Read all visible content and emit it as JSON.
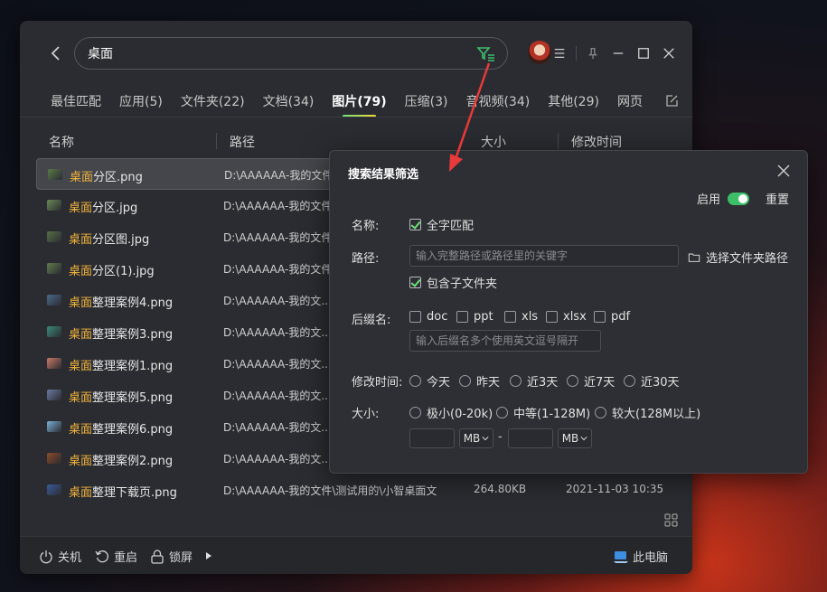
{
  "search": {
    "value": "桌面",
    "placeholder": ""
  },
  "tabs": [
    {
      "label": "最佳匹配"
    },
    {
      "label": "应用(5)"
    },
    {
      "label": "文件夹(22)"
    },
    {
      "label": "文档(34)"
    },
    {
      "label": "图片(79)",
      "active": true
    },
    {
      "label": "压缩(3)"
    },
    {
      "label": "音视频(34)"
    },
    {
      "label": "其他(29)"
    },
    {
      "label": "网页"
    }
  ],
  "columns": {
    "name": "名称",
    "path": "路径",
    "size": "大小",
    "modified": "修改时间"
  },
  "files": [
    {
      "hl": "桌面",
      "rest": "分区.png",
      "path": "D:\\AAAAAA-我的文件",
      "size": "",
      "date": "",
      "thumb": "#5a7a4a"
    },
    {
      "hl": "桌面",
      "rest": "分区.jpg",
      "path": "D:\\AAAAAA-我的文件",
      "size": "",
      "date": "",
      "thumb": "#6a8a56"
    },
    {
      "hl": "桌面",
      "rest": "分区图.jpg",
      "path": "D:\\AAAAAA-我的文件",
      "size": "",
      "date": "",
      "thumb": "#587048"
    },
    {
      "hl": "桌面",
      "rest": "分区(1).jpg",
      "path": "D:\\AAAAAA-我的文件",
      "size": "",
      "date": "",
      "thumb": "#607a4e"
    },
    {
      "hl": "桌面",
      "rest": "整理案例4.png",
      "path": "D:\\AAAAAA-我的文...",
      "size": "",
      "date": "",
      "thumb": "#4a6a8a"
    },
    {
      "hl": "桌面",
      "rest": "整理案例3.png",
      "path": "D:\\AAAAAA-我的文...",
      "size": "",
      "date": "",
      "thumb": "#3a8a7a"
    },
    {
      "hl": "桌面",
      "rest": "整理案例1.png",
      "path": "D:\\AAAAAA-我的文...",
      "size": "",
      "date": "",
      "thumb": "#c87a6a"
    },
    {
      "hl": "桌面",
      "rest": "整理案例5.png",
      "path": "D:\\AAAAAA-我的文...",
      "size": "",
      "date": "",
      "thumb": "#6a7aa0"
    },
    {
      "hl": "桌面",
      "rest": "整理案例6.png",
      "path": "D:\\AAAAAA-我的文...",
      "size": "",
      "date": "",
      "thumb": "#7ab0d8"
    },
    {
      "hl": "桌面",
      "rest": "整理案例2.png",
      "path": "D:\\AAAAAA-我的文...",
      "size": "",
      "date": "",
      "thumb": "#8a4a2a"
    },
    {
      "hl": "桌面",
      "rest": "整理下载页.png",
      "path": "D:\\AAAAAA-我的文件\\测试用的\\小智桌面文",
      "size": "264.80KB",
      "date": "2021-11-03 10:35",
      "thumb": "#3a5a9a"
    }
  ],
  "bottom": {
    "shutdown": "关机",
    "restart": "重启",
    "lock": "锁屏",
    "computer": "此电脑"
  },
  "filter": {
    "title": "搜索结果筛选",
    "enable_label": "启用",
    "enabled": true,
    "reset_label": "重置",
    "name_label": "名称:",
    "full_match": "全字匹配",
    "path_label": "路径:",
    "path_placeholder": "输入完整路径或路径里的关键字",
    "choose_folder": "选择文件夹路径",
    "include_sub": "包含子文件夹",
    "ext_label": "后缀名:",
    "ext_options": [
      "doc",
      "ppt",
      "xls",
      "xlsx",
      "pdf"
    ],
    "ext_placeholder": "输入后缀名多个使用英文逗号隔开",
    "mtime_label": "修改时间:",
    "mtime_options": [
      "今天",
      "昨天",
      "近3天",
      "近7天",
      "近30天"
    ],
    "size_label": "大小:",
    "size_options": [
      "极小(0-20k)",
      "中等(1-128M)",
      "较大(128M以上)"
    ],
    "unit_left": "MB",
    "unit_right": "MB",
    "range_sep": "-"
  },
  "colors": {
    "accent_green": "#3dbf6a",
    "highlight": "#f0b43c",
    "arrow": "#e83a3a"
  }
}
